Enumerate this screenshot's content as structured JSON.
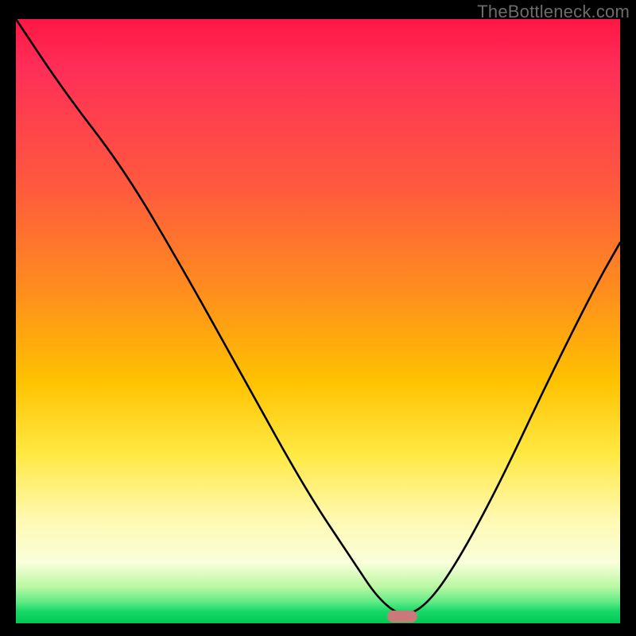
{
  "watermark": {
    "text": "TheBottleneck.com"
  },
  "chart_data": {
    "type": "line",
    "title": "",
    "xlabel": "",
    "ylabel": "",
    "xlim": [
      0,
      100
    ],
    "ylim": [
      0,
      100
    ],
    "series": [
      {
        "name": "bottleneck-curve",
        "x": [
          0,
          8,
          18,
          28,
          38,
          48,
          56,
          60,
          64,
          68,
          73,
          80,
          88,
          96,
          100
        ],
        "values": [
          100,
          88,
          75,
          58,
          40,
          22,
          10,
          4,
          1,
          3,
          10,
          23,
          40,
          56,
          63
        ]
      }
    ],
    "marker": {
      "x": 64,
      "y": 1
    },
    "gradient_stops": [
      {
        "pos": 0,
        "color": "#ff1744"
      },
      {
        "pos": 28,
        "color": "#ff5a3d"
      },
      {
        "pos": 60,
        "color": "#ffc200"
      },
      {
        "pos": 90,
        "color": "#f9ffdb"
      },
      {
        "pos": 100,
        "color": "#00c853"
      }
    ]
  }
}
